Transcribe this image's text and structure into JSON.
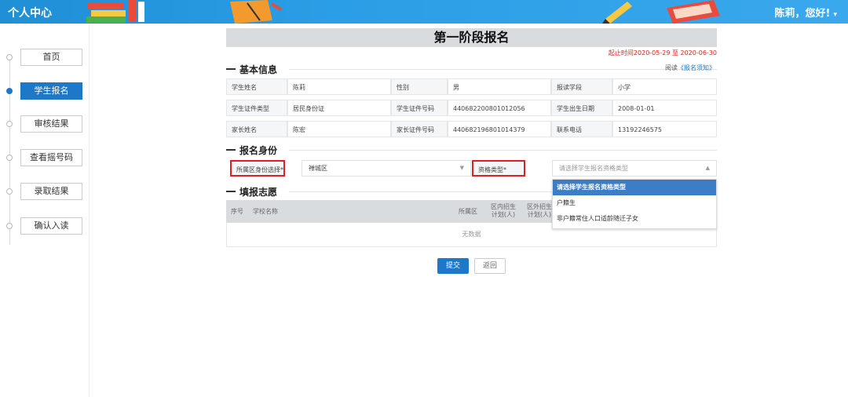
{
  "header": {
    "title": "个人中心",
    "greeting": "陈莉，您好!",
    "caret": "▾"
  },
  "sidebar": {
    "items": [
      {
        "label": "首页",
        "active": false
      },
      {
        "label": "学生报名",
        "active": true
      },
      {
        "label": "审核结果",
        "active": false
      },
      {
        "label": "查看摇号码",
        "active": false
      },
      {
        "label": "录取结果",
        "active": false
      },
      {
        "label": "确认入读",
        "active": false
      }
    ]
  },
  "page": {
    "title": "第一阶段报名",
    "deadline": "起止时间2020-05-29 至 2020-06-30",
    "read_prefix": "阅读",
    "read_link": "《报名须知》"
  },
  "basic": {
    "heading": "基本信息",
    "rows": [
      [
        {
          "label": "学生姓名",
          "value": "陈莉"
        },
        {
          "label": "性别",
          "value": "男"
        },
        {
          "label": "报读学段",
          "value": "小学"
        }
      ],
      [
        {
          "label": "学生证件类型",
          "value": "居民身份证"
        },
        {
          "label": "学生证件号码",
          "value": "440682200801012056"
        },
        {
          "label": "学生出生日期",
          "value": "2008-01-01"
        }
      ],
      [
        {
          "label": "家长姓名",
          "value": "陈宏"
        },
        {
          "label": "家长证件号码",
          "value": "440682196801014379"
        },
        {
          "label": "联系电话",
          "value": "13192246575"
        }
      ]
    ]
  },
  "identity": {
    "heading": "报名身份",
    "district_label": "所属区身份选择*",
    "district_value": "禅城区",
    "qual_label": "资格类型*",
    "qual_placeholder": "请选择学生报名资格类型",
    "options": [
      "请选择学生报名资格类型",
      "户籍生",
      "非户籍常住人口适龄随迁子女"
    ]
  },
  "wish": {
    "heading": "填报志愿",
    "columns": {
      "no": "序号",
      "school": "学校名称",
      "district": "所属区",
      "in_plan": "区内招生计划(人)",
      "out_plan": "区外招生计划(人)"
    },
    "empty": "无数据"
  },
  "actions": {
    "submit": "提交",
    "back": "返回"
  },
  "colors": {
    "primary": "#1e78c8",
    "header": "#2a9ee6",
    "alert": "#e02020"
  }
}
